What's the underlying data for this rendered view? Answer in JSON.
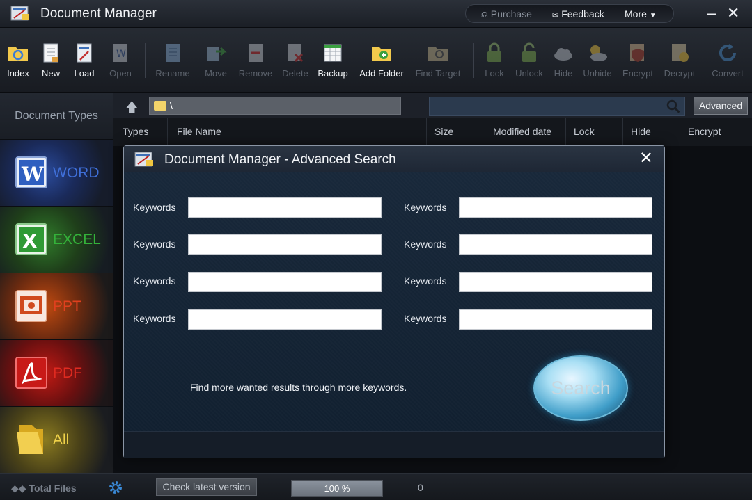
{
  "window": {
    "title": "Document Manager",
    "topmenu": {
      "purchase": "Purchase",
      "feedback": "Feedback",
      "more": "More"
    }
  },
  "toolbar": {
    "index": "Index",
    "new": "New",
    "load": "Load",
    "open": "Open",
    "rename": "Rename",
    "move": "Move",
    "remove": "Remove",
    "delete": "Delete",
    "backup": "Backup",
    "add_folder": "Add Folder",
    "find_target": "Find Target",
    "lock": "Lock",
    "unlock": "Unlock",
    "hide": "Hide",
    "unhide": "Unhide",
    "encrypt": "Encrypt",
    "decrypt": "Decrypt",
    "convert": "Convert"
  },
  "sidebar": {
    "header": "Document Types",
    "items": [
      {
        "label": "WORD",
        "color": "#3f6fd8"
      },
      {
        "label": "EXCEL",
        "color": "#34b23a"
      },
      {
        "label": "PPT",
        "color": "#e0401e"
      },
      {
        "label": "PDF",
        "color": "#e02a20"
      },
      {
        "label": "All",
        "color": "#f0d24a"
      }
    ]
  },
  "pathbar": {
    "path": "\\",
    "advanced": "Advanced",
    "search_value": ""
  },
  "table": {
    "columns": [
      "Types",
      "File Name",
      "Size",
      "Modified date",
      "Lock",
      "Hide",
      "Encrypt"
    ]
  },
  "status": {
    "total_files": "Total Files",
    "check_version": "Check latest version",
    "progress_text": "100 %",
    "progress": 1.0,
    "count": "0"
  },
  "dialog": {
    "title": "Document Manager - Advanced Search",
    "keyword_label": "Keywords",
    "keywords": [
      "",
      "",
      "",
      "",
      "",
      "",
      "",
      ""
    ],
    "hint": "Find more wanted results through more keywords.",
    "search": "Search"
  },
  "colors": {
    "accent": "#3f9dc8",
    "dialog_bg": "#142030"
  }
}
